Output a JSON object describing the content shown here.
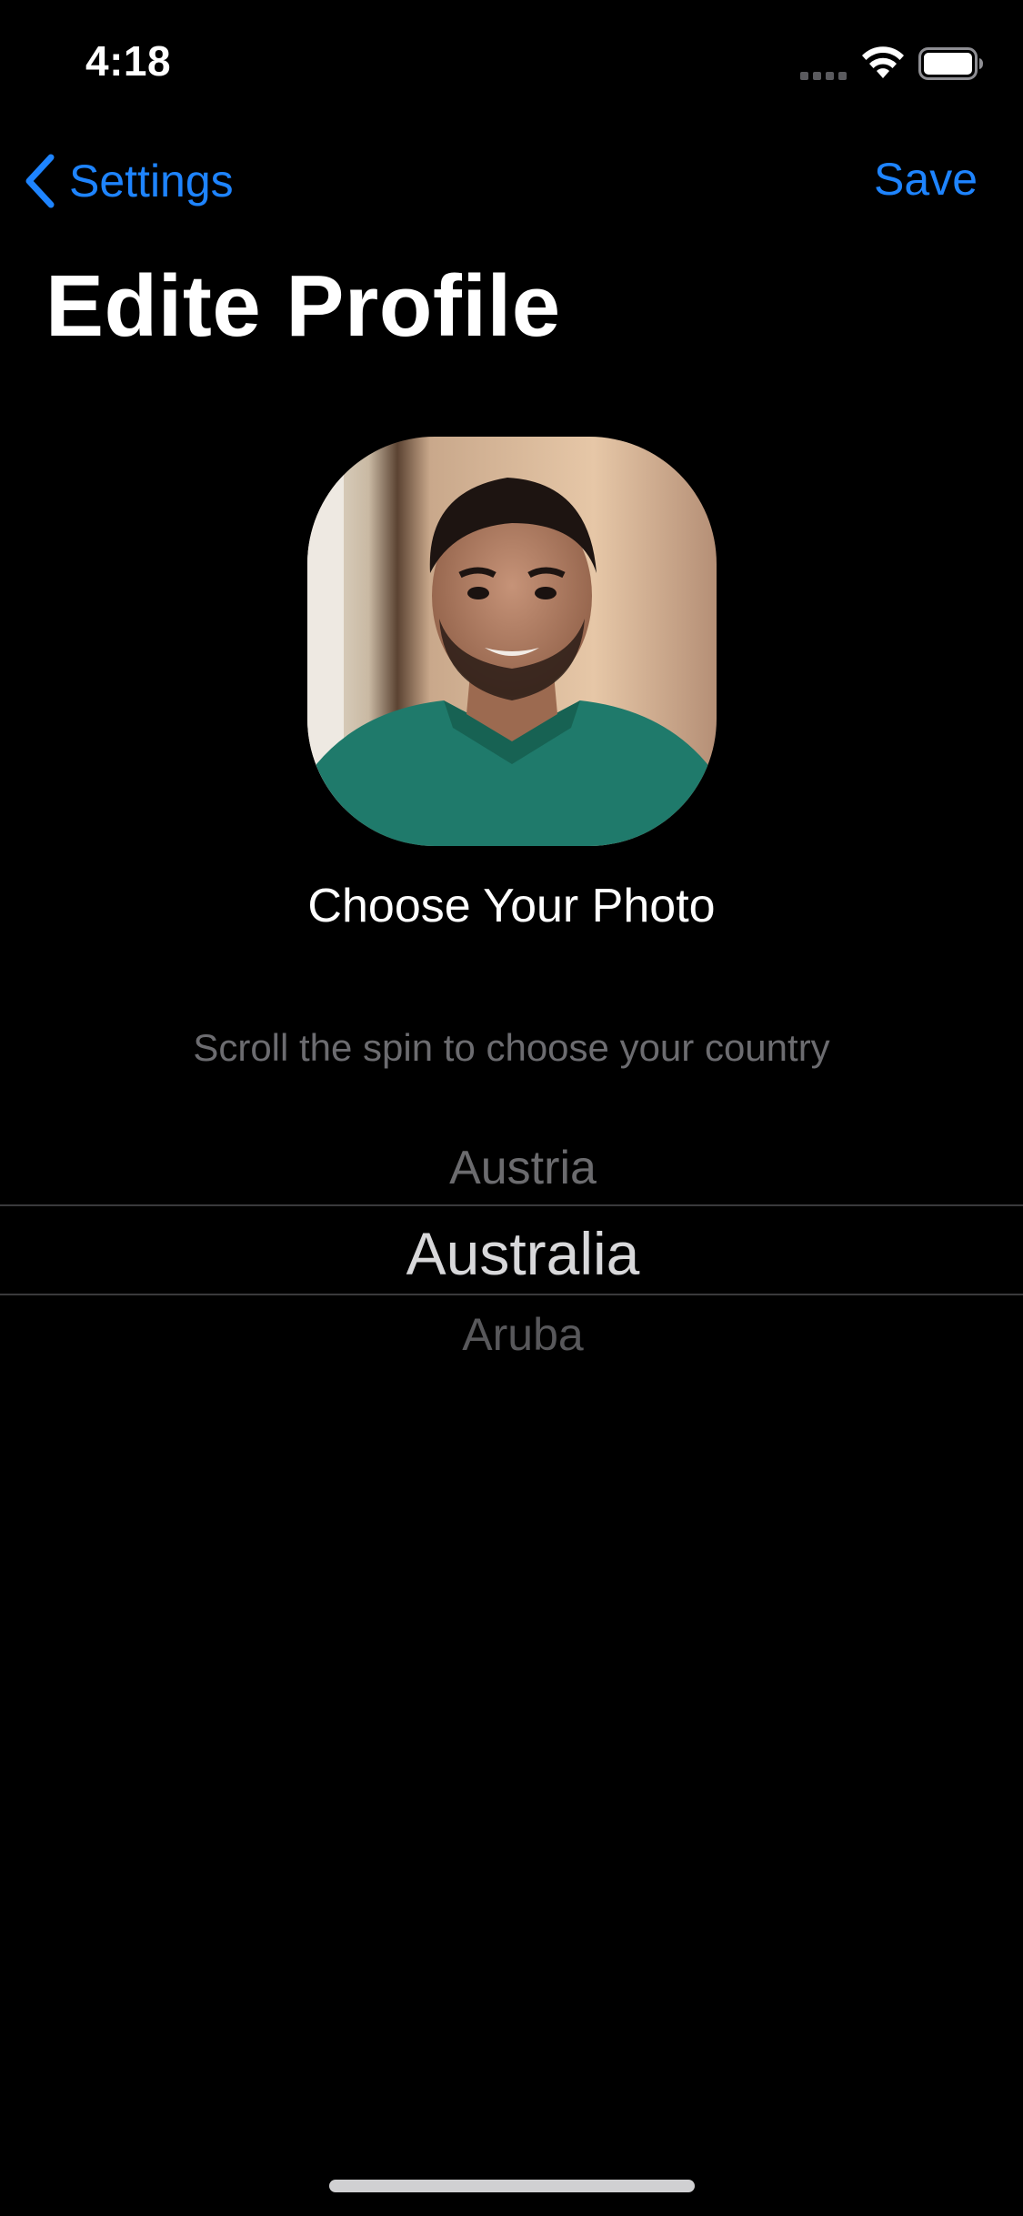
{
  "status_bar": {
    "time": "4:18"
  },
  "nav": {
    "back_label": "Settings",
    "save_label": "Save"
  },
  "page": {
    "title": "Edite Profile"
  },
  "profile": {
    "choose_photo_label": "Choose Your Photo",
    "country_hint": "Scroll the spin to choose your country"
  },
  "country_picker": {
    "above_item": "Austria",
    "selected_item": "Australia",
    "below_item": "Aruba"
  },
  "colors": {
    "background": "#000000",
    "accent": "#1e84ff",
    "secondary_text": "#6c6c70"
  },
  "icons": {
    "back": "chevron-left-icon",
    "signal": "cellular-signal-icon",
    "wifi": "wifi-icon",
    "battery": "battery-icon"
  }
}
